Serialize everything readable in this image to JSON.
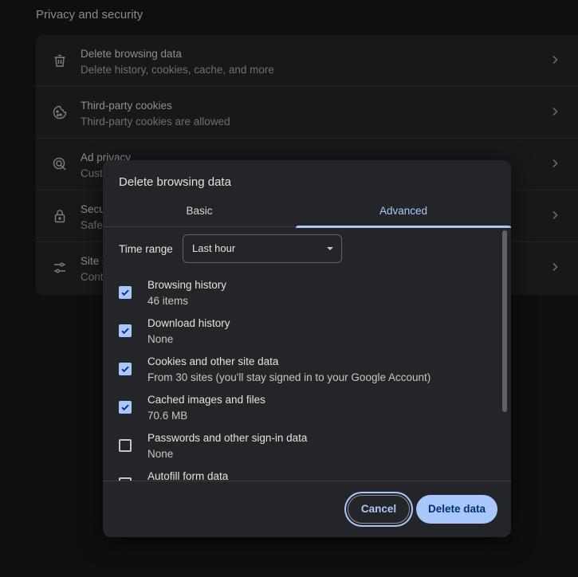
{
  "background": {
    "section_title": "Privacy and security",
    "rows": [
      {
        "title": "Delete browsing data",
        "subtitle": "Delete history, cookies, cache, and more",
        "icon": "trash-icon"
      },
      {
        "title": "Third-party cookies",
        "subtitle": "Third-party cookies are allowed",
        "icon": "cookie-icon"
      },
      {
        "title": "Ad privacy",
        "subtitle": "Cust",
        "icon": "ad-privacy-icon"
      },
      {
        "title": "Secu",
        "subtitle": "Safe",
        "icon": "lock-icon"
      },
      {
        "title": "Site s",
        "subtitle": "Cont",
        "icon": "sliders-icon"
      }
    ]
  },
  "dialog": {
    "title": "Delete browsing data",
    "tabs": {
      "basic": "Basic",
      "advanced": "Advanced",
      "active": "advanced"
    },
    "time_range": {
      "label": "Time range",
      "value": "Last hour"
    },
    "options": [
      {
        "title": "Browsing history",
        "subtitle": "46 items",
        "checked": true
      },
      {
        "title": "Download history",
        "subtitle": "None",
        "checked": true
      },
      {
        "title": "Cookies and other site data",
        "subtitle": "From 30 sites (you'll stay signed in to your Google Account)",
        "checked": true
      },
      {
        "title": "Cached images and files",
        "subtitle": "70.6 MB",
        "checked": true
      },
      {
        "title": "Passwords and other sign-in data",
        "subtitle": "None",
        "checked": false
      },
      {
        "title": "Autofill form data",
        "subtitle": "",
        "checked": false
      }
    ],
    "buttons": {
      "cancel": "Cancel",
      "delete": "Delete data"
    }
  },
  "colors": {
    "accent": "#a8c7fa",
    "dialog_bg": "#242528",
    "page_bg": "#0f0f0f"
  }
}
